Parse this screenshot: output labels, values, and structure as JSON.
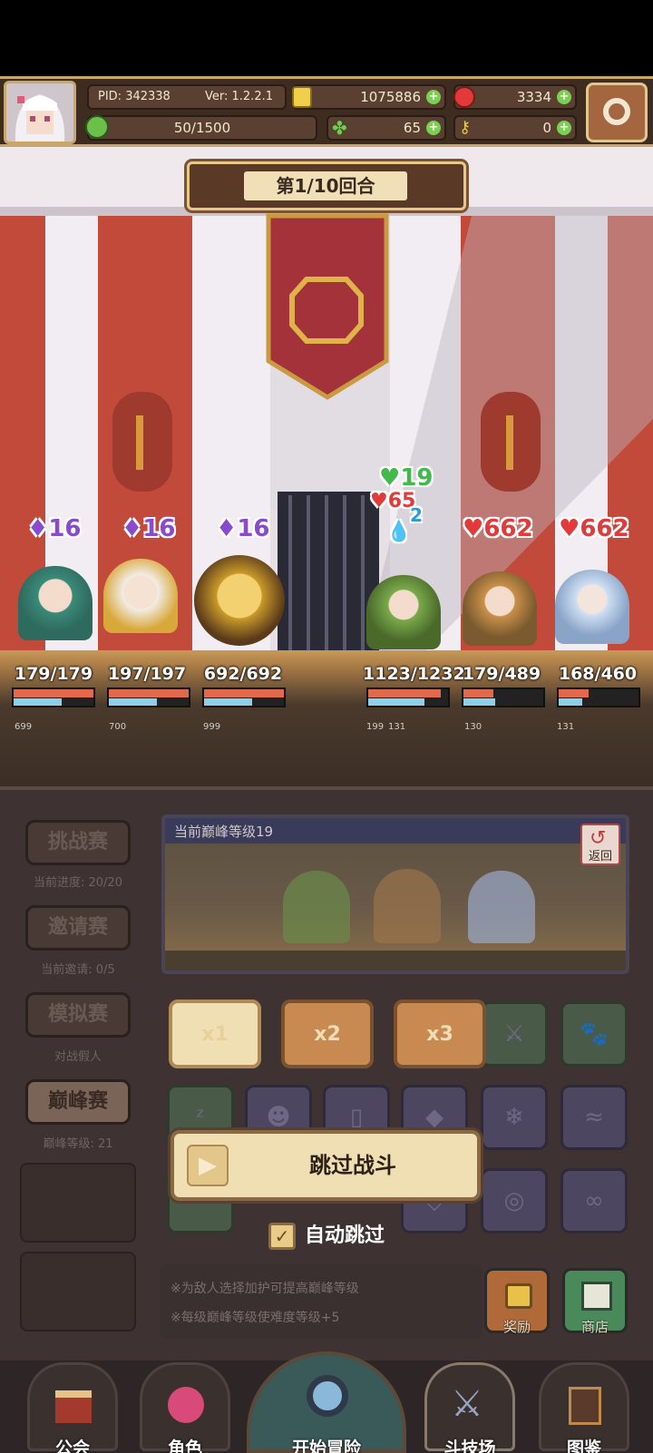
{
  "header": {
    "pid": "PID: 342338",
    "version": "Ver: 1.2.2.1",
    "gold": "1075886",
    "gems": "3334",
    "energy": "50/1500",
    "clover": "65",
    "keys": "0"
  },
  "battle": {
    "round": "第1/10回合",
    "allies": [
      {
        "hp": "179/179",
        "hp_frac": 1.0,
        "buff": "16",
        "id": "699"
      },
      {
        "hp": "197/197",
        "hp_frac": 1.0,
        "buff": "16",
        "id": "700"
      },
      {
        "hp": "692/692",
        "hp_frac": 1.0,
        "buff": "16",
        "id": "999"
      }
    ],
    "enemies": [
      {
        "hp": "1123/1232",
        "hp_frac": 0.91,
        "id_a": "199",
        "id_b": "131"
      },
      {
        "hp": "179/489",
        "hp_frac": 0.37,
        "dmg": "662",
        "id": "130"
      },
      {
        "hp": "168/460",
        "hp_frac": 0.37,
        "dmg": "662",
        "id": "131"
      }
    ],
    "effect_heal": "19",
    "effect_dmg": "65",
    "effect_small": "2"
  },
  "sidebar": {
    "challenge": {
      "label": "挑战赛",
      "caption": "当前进度: 20/20"
    },
    "invite": {
      "label": "邀请赛",
      "caption": "当前邀请: 0/5"
    },
    "sim": {
      "label": "模拟赛",
      "caption": "对战假人"
    },
    "peak": {
      "label": "巅峰赛",
      "caption": "巅峰等级: 21"
    }
  },
  "preview": {
    "title": "当前巅峰等级19",
    "back": "返回"
  },
  "speed": [
    "x1",
    "x2",
    "x3"
  ],
  "skip": {
    "label": "跳过战斗"
  },
  "auto_skip": {
    "label": "自动跳过"
  },
  "notes": [
    "※为敌人选择加护可提高巅峰等级",
    "※每级巅峰等级使难度等级+5"
  ],
  "buttons": {
    "reward": "奖励",
    "shop": "商店"
  },
  "nav": {
    "guild": "公会",
    "role": "角色",
    "adventure": "开始冒险",
    "arena": "斗技场",
    "codex": "图鉴"
  },
  "colors": {
    "hp_red": "#e26a4c",
    "hp_blue": "#8fd0e8",
    "accent_gold": "#c9a76a"
  }
}
